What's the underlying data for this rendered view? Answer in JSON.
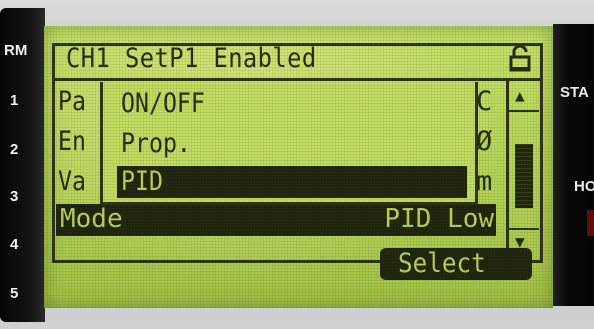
{
  "side_labels": [
    "RM",
    "1",
    "2",
    "3",
    "4",
    "5"
  ],
  "right_labels": [
    "STA",
    "HO"
  ],
  "lcd": {
    "title": "CH1 SetP1 Enabled",
    "lock_icon": "lock-icon",
    "background_rows": {
      "row1_prefix": "Pa",
      "row1_suffix": "C",
      "row2_prefix": "En",
      "row2_suffix": "Ø",
      "row3_prefix": "Va",
      "row3_suffix": "m"
    },
    "mode_row": {
      "label": "Mode",
      "value": "PID Low"
    },
    "popup": {
      "items": [
        "ON/OFF",
        "Prop.",
        "PID"
      ],
      "selected": "PID"
    },
    "scrollbar": {
      "up_icon": "scroll-up-arrow-icon",
      "down_icon": "scroll-down-arrow-icon"
    },
    "softkey": {
      "label": "Select"
    }
  }
}
